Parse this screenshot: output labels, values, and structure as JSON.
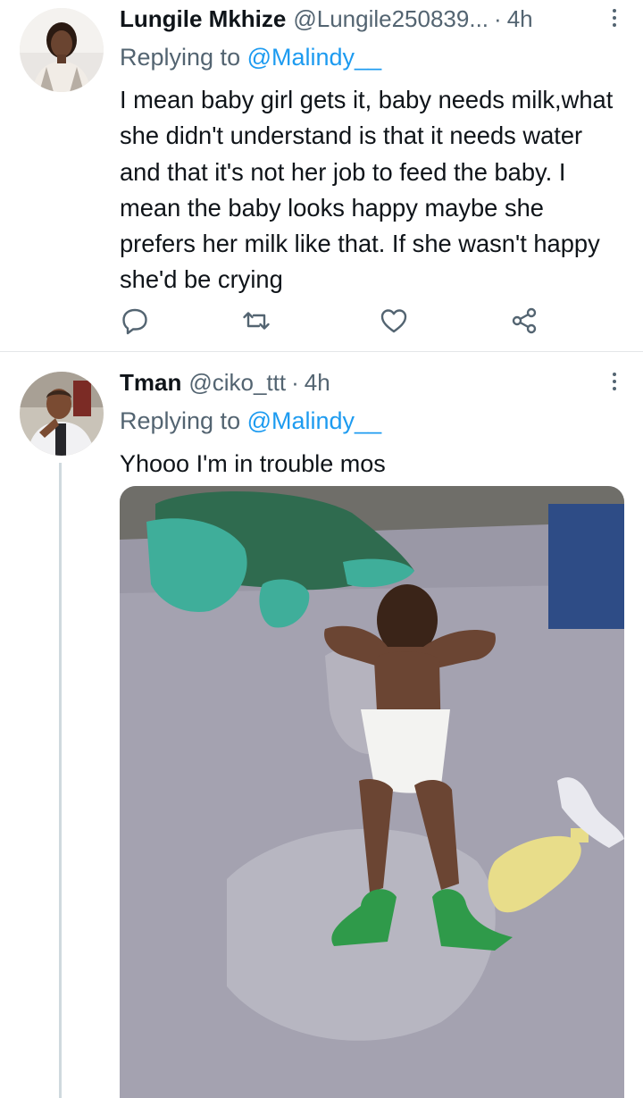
{
  "tweets": [
    {
      "name": "Lungile Mkhize",
      "handle": "@Lungile250839...",
      "separator": "·",
      "time": "4h",
      "replying_prefix": "Replying to",
      "replying_to": "@Malindy__",
      "text": "I mean baby girl gets it, baby needs milk,what she didn't understand is that it needs water and that it's not her job to feed the baby. I mean the baby looks happy maybe she prefers her milk like that. If she wasn't happy she'd be crying",
      "icons": {
        "avatar": "profile-photo",
        "more": "more-vertical-icon",
        "reply": "reply-icon",
        "retweet": "retweet-icon",
        "like": "heart-icon",
        "share": "share-icon"
      }
    },
    {
      "name": "Tman",
      "handle": "@ciko_ttt",
      "separator": "·",
      "time": "4h",
      "replying_prefix": "Replying to",
      "replying_to": "@Malindy__",
      "text": "Yhooo I'm in trouble mos",
      "icons": {
        "avatar": "profile-photo",
        "more": "more-vertical-icon",
        "media": "attached-photo"
      }
    }
  ],
  "colors": {
    "text": "#0f1419",
    "secondary": "#536471",
    "link": "#1d9bf0",
    "thread_line": "#cfd9de"
  }
}
